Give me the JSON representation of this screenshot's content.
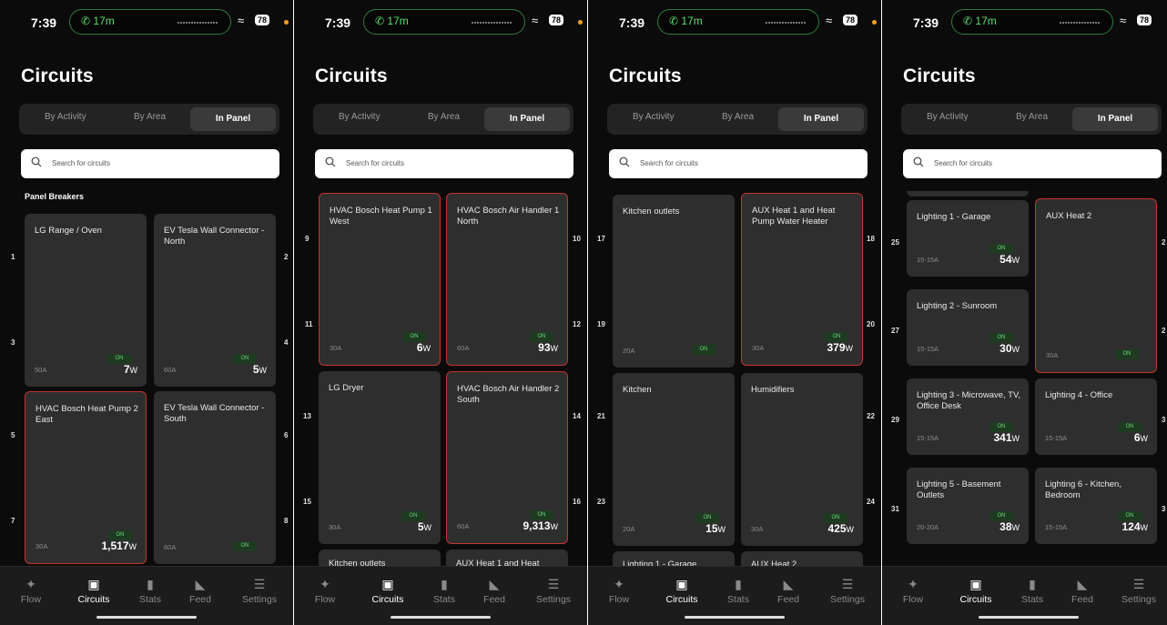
{
  "screens": [
    {
      "status": {
        "time": "7:39",
        "call": "17m",
        "battery": "78"
      },
      "title": "Circuits",
      "segments": [
        "By Activity",
        "By Area",
        "In Panel"
      ],
      "search_placeholder": "Search for circuits",
      "subheading": "Panel Breakers",
      "cards": [
        {
          "name": "LG Range / Oven",
          "amp": "50A",
          "on": "ON",
          "watts": "7",
          "unit": "W"
        },
        {
          "name": "EV Tesla Wall Connector - North",
          "amp": "60A",
          "on": "ON",
          "watts": "5",
          "unit": "W"
        },
        {
          "name": "HVAC Bosch Heat Pump 2 East",
          "amp": "30A",
          "on": "ON",
          "watts": "1,517",
          "unit": "W"
        },
        {
          "name": "EV Tesla Wall Connector - South",
          "amp": "60A",
          "on": "ON",
          "watts": "",
          "unit": ""
        }
      ],
      "numbers": [
        "1",
        "2",
        "3",
        "4",
        "5",
        "6",
        "7",
        "8"
      ]
    },
    {
      "status": {
        "time": "7:39",
        "call": "17m",
        "battery": "78"
      },
      "title": "Circuits",
      "segments": [
        "By Activity",
        "By Area",
        "In Panel"
      ],
      "search_placeholder": "Search for circuits",
      "cards": [
        {
          "name": "HVAC Bosch Heat Pump 1 West",
          "amp": "30A",
          "on": "ON",
          "watts": "6",
          "unit": "W"
        },
        {
          "name": "HVAC Bosch Air Handler 1 North",
          "amp": "60A",
          "on": "ON",
          "watts": "93",
          "unit": "W"
        },
        {
          "name": "LG Dryer",
          "amp": "30A",
          "on": "ON",
          "watts": "5",
          "unit": "W"
        },
        {
          "name": "HVAC Bosch Air Handler 2 South",
          "amp": "60A",
          "on": "ON",
          "watts": "9,313",
          "unit": "W"
        },
        {
          "name": "Kitchen outlets",
          "amp": "",
          "on": "",
          "watts": "",
          "unit": ""
        },
        {
          "name": "AUX Heat 1 and Heat",
          "amp": "",
          "on": "",
          "watts": "",
          "unit": ""
        }
      ],
      "numbers": [
        "9",
        "10",
        "11",
        "12",
        "13",
        "14",
        "15",
        "16"
      ]
    },
    {
      "status": {
        "time": "7:39",
        "call": "17m",
        "battery": "78"
      },
      "title": "Circuits",
      "segments": [
        "By Activity",
        "By Area",
        "In Panel"
      ],
      "search_placeholder": "Search for circuits",
      "cards": [
        {
          "name": "Kitchen outlets",
          "amp": "20A",
          "on": "ON",
          "watts": "",
          "unit": ""
        },
        {
          "name": "AUX Heat 1 and Heat Pump Water Heater",
          "amp": "30A",
          "on": "ON",
          "watts": "379",
          "unit": "W"
        },
        {
          "name": "Kitchen",
          "amp": "20A",
          "on": "ON",
          "watts": "15",
          "unit": "W"
        },
        {
          "name": "Humidifiers",
          "amp": "30A",
          "on": "ON",
          "watts": "425",
          "unit": "W"
        },
        {
          "name": "Lighting 1 - Garage",
          "amp": "",
          "on": "",
          "watts": "",
          "unit": ""
        },
        {
          "name": "AUX Heat 2",
          "amp": "",
          "on": "",
          "watts": "",
          "unit": ""
        }
      ],
      "numbers": [
        "17",
        "18",
        "19",
        "20",
        "21",
        "22",
        "23",
        "24"
      ]
    },
    {
      "status": {
        "time": "7:39",
        "call": "17m",
        "battery": "78"
      },
      "title": "Circuits",
      "segments": [
        "By Activity",
        "By Area",
        "In Panel"
      ],
      "search_placeholder": "Search for circuits",
      "cards": [
        {
          "name": "Lighting 1 - Garage",
          "amp": "15-15A",
          "on": "ON",
          "watts": "54",
          "unit": "W"
        },
        {
          "name": "AUX Heat 2",
          "amp": "30A",
          "on": "ON",
          "watts": "",
          "unit": ""
        },
        {
          "name": "Lighting 2 - Sunroom",
          "amp": "15-15A",
          "on": "ON",
          "watts": "30",
          "unit": "W"
        },
        {
          "name": "Lighting 3 - Microwave, TV, Office Desk",
          "amp": "15-15A",
          "on": "ON",
          "watts": "341",
          "unit": "W"
        },
        {
          "name": "Lighting 4 - Office",
          "amp": "15-15A",
          "on": "ON",
          "watts": "6",
          "unit": "W"
        },
        {
          "name": "Lighting 5 - Basement Outlets",
          "amp": "20-20A",
          "on": "ON",
          "watts": "38",
          "unit": "W"
        },
        {
          "name": "Lighting 6 - Kitchen, Bedroom",
          "amp": "15-15A",
          "on": "ON",
          "watts": "124",
          "unit": "W"
        }
      ],
      "numbers": [
        "25",
        "27",
        "29",
        "31",
        "2",
        "2",
        "3",
        "3"
      ]
    }
  ],
  "tabbar": [
    "Flow",
    "Circuits",
    "Stats",
    "Feed",
    "Settings"
  ],
  "icons": [
    "phone-icon",
    "wifi-icon",
    "search-icon",
    "flow-icon",
    "circuits-icon",
    "stats-icon",
    "feed-icon",
    "settings-icon"
  ],
  "colors": {
    "background": "#0b0b0b",
    "card": "#2e2e2e",
    "highlight": "#c2352e",
    "on_badge": "#6cd47a",
    "call_green": "#5ee06b"
  }
}
